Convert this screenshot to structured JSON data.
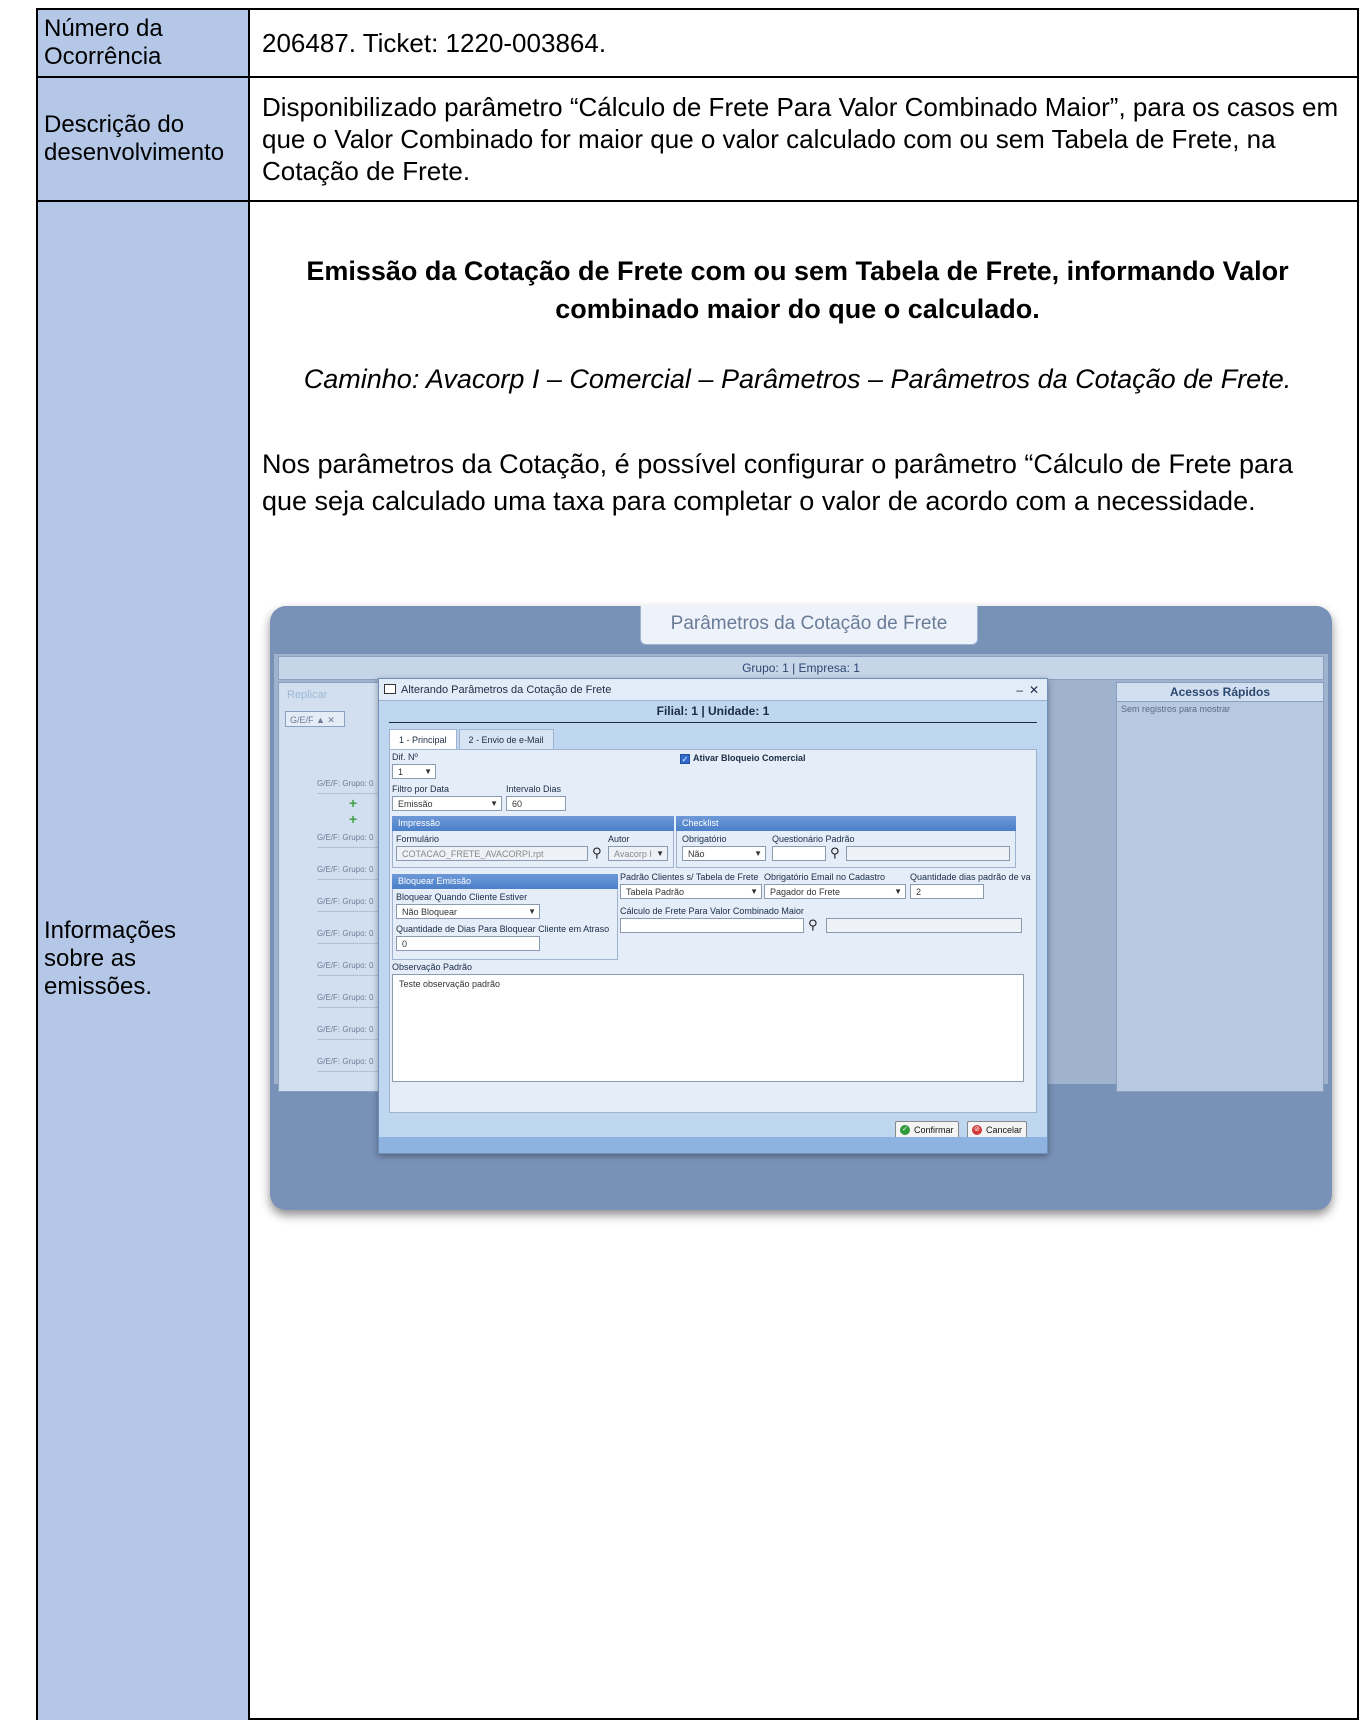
{
  "rows": {
    "ocorrencia": {
      "label": "Número da Ocorrência",
      "value": "206487. Ticket: 1220-003864."
    },
    "descricao": {
      "label": "Descrição do desenvolvimento",
      "value": "Disponibilizado parâmetro “Cálculo de Frete Para Valor Combinado Maior”, para os casos em que o Valor Combinado for maior que o valor calculado com ou sem Tabela de Frete, na Cotação de Frete."
    },
    "informacoes": {
      "label_lines": [
        "Informações",
        "sobre as",
        "emissões."
      ],
      "heading": "Emissão da Cotação de Frete com ou sem Tabela de Frete, informando Valor combinado maior do que o calculado.",
      "path": "Caminho: Avacorp I – Comercial – Parâmetros – Parâmetros da Cotação de Frete.",
      "paragraph": "Nos parâmetros da Cotação, é possível configurar o parâmetro “Cálculo de Frete para que seja calculado uma taxa para completar o valor de acordo com a necessidade."
    }
  },
  "screenshot": {
    "window_title": "Parâmetros da Cotação de Frete",
    "group_bar": "Grupo: 1 | Empresa: 1",
    "replicar": "Replicar",
    "filter_chip": "G/E/F ▲ ✕",
    "left_rows": [
      "G/E/F: Grupo: 0",
      "G/E/F: Grupo: 0",
      "G/E/F: Grupo: 0",
      "G/E/F: Grupo: 0",
      "G/E/F: Grupo: 0",
      "G/E/F: Grupo: 0",
      "G/E/F: Grupo: 0",
      "G/E/F: Grupo: 0",
      "G/E/F: Grupo: 0",
      "G/E/F: Grupo: 0"
    ],
    "right_panel": {
      "title": "Acessos Rápidos",
      "empty": "Sem registros para mostrar"
    },
    "dialog": {
      "title": "Alterando Parâmetros da Cotação de Frete",
      "filial": "Filial: 1 | Unidade: 1",
      "tabs": [
        "1 - Principal",
        "2 - Envio de e-Mail"
      ],
      "dif_label": "Dif. Nº",
      "dif_value": "1",
      "ativar_bloqueio": "Ativar Bloqueio Comercial",
      "filtro_label": "Filtro por Data",
      "filtro_value": "Emissão",
      "intervalo_label": "Intervalo Dias",
      "intervalo_value": "60",
      "impressao_header": "Impressão",
      "formulario_label": "Formulário",
      "formulario_value": "COTACAO_FRETE_AVACORPI.rpt",
      "autor_label": "Autor",
      "autor_value": "Avacorp I",
      "checklist_header": "Checklist",
      "obrigatorio_label": "Obrigatório",
      "obrigatorio_value": "Não",
      "questionario_label": "Questionário Padrão",
      "bloquear_header": "Bloquear Emissão",
      "bloquear_quando_label": "Bloquear Quando Cliente Estiver",
      "bloquear_quando_value": "Não Bloquear",
      "qtd_dias_bloq_label": "Quantidade de Dias Para Bloquear Cliente em Atraso",
      "qtd_dias_bloq_value": "0",
      "padrao_clientes_label": "Padrão Clientes s/ Tabela de Frete",
      "padrao_clientes_value": "Tabela Padrão",
      "obrig_email_label": "Obrigatório Email no Cadastro",
      "obrig_email_value": "Pagador do Frete",
      "qtd_dias_padrao_label": "Quantidade dias padrão de va",
      "qtd_dias_padrao_value": "2",
      "calculo_label": "Cálculo de Frete Para Valor Combinado Maior",
      "observacao_label": "Observação Padrão",
      "observacao_value": "Teste observação padrão",
      "confirmar": "Confirmar",
      "cancelar": "Cancelar"
    }
  }
}
